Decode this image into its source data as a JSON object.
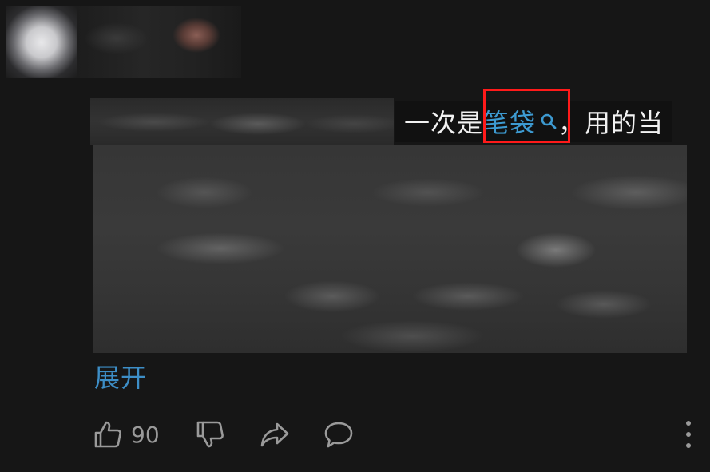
{
  "comment": {
    "text_before": "一次是",
    "keyword": "笔袋",
    "text_after": "，用的当",
    "expand_label": "展开"
  },
  "actions": {
    "like_count": "90",
    "icons": [
      "thumbs-up-icon",
      "thumbs-down-icon",
      "share-icon",
      "reply-icon",
      "more-vertical-icon"
    ]
  },
  "colors": {
    "background": "#161616",
    "link": "#3d9ad1",
    "highlight": "#ff1a1a",
    "icon": "#9a9a9a"
  }
}
